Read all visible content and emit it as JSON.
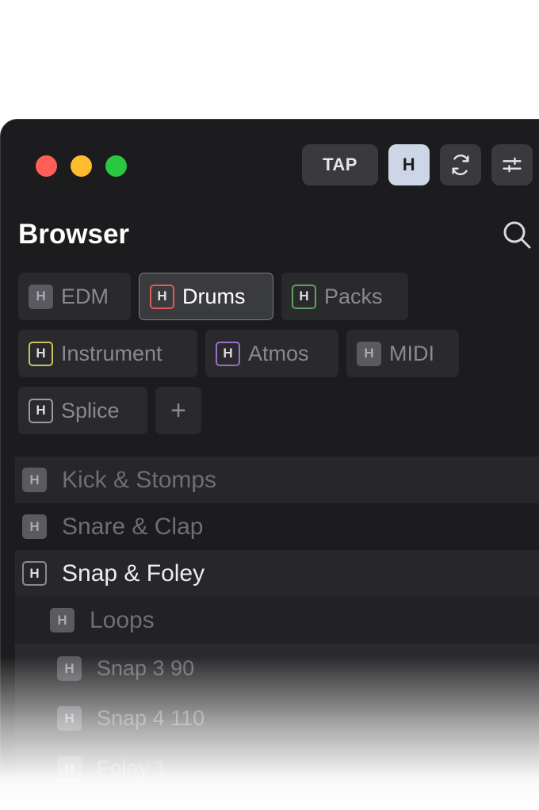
{
  "window": {
    "toolbar": {
      "tap_label": "TAP",
      "h_label": "H"
    },
    "title": "Browser"
  },
  "chips": [
    [
      {
        "label": "EDM",
        "badge": "H"
      },
      {
        "label": "Drums",
        "badge": "H",
        "active": true
      },
      {
        "label": "Packs",
        "badge": "H"
      }
    ],
    [
      {
        "label": "Instrument",
        "badge": "H"
      },
      {
        "label": "Atmos",
        "badge": "H"
      },
      {
        "label": "MIDI",
        "badge": "H"
      }
    ],
    [
      {
        "label": "Splice",
        "badge": "H"
      }
    ]
  ],
  "add_chip_label": "+",
  "badge_colors": {
    "drums": "#e35a5a",
    "packs": "#5fa063",
    "instrument": "#c9c45a",
    "atmos": "#9a6fd0",
    "splice": "#9a9aa0"
  },
  "list": [
    {
      "label": "Kick & Stomps",
      "badge": "H",
      "level": 1
    },
    {
      "label": "Snare & Clap",
      "badge": "H",
      "level": 1
    },
    {
      "label": "Snap & Foley",
      "badge": "H",
      "level": 1,
      "expanded": true
    },
    {
      "label": "Loops",
      "badge": "H",
      "level": 2
    },
    {
      "label": "Snap 3 90",
      "badge": "H",
      "level": 3
    },
    {
      "label": "Snap 4 110",
      "badge": "H",
      "level": 3
    },
    {
      "label": "Foley 1",
      "badge": "H",
      "level": 3
    }
  ]
}
